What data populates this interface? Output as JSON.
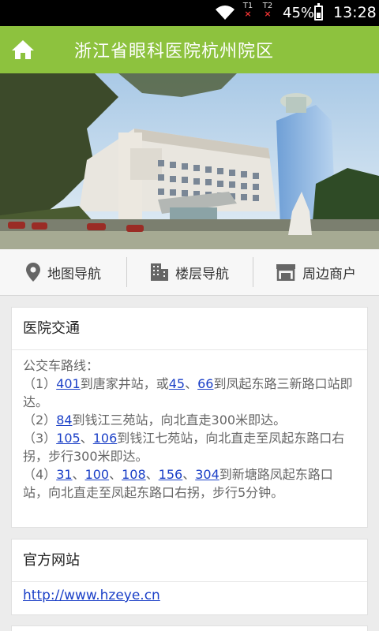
{
  "status_bar": {
    "sim1": "T1",
    "sim2": "T2",
    "battery_percent": "45%",
    "battery_level": 0.45,
    "time": "13:28"
  },
  "app_bar": {
    "title": "浙江省眼科医院杭州院区",
    "color": "#8dc23e"
  },
  "tabs": [
    {
      "label": "地图导航",
      "icon": "map-pin-icon"
    },
    {
      "label": "楼层导航",
      "icon": "building-icon"
    },
    {
      "label": "周边商户",
      "icon": "storefront-icon"
    }
  ],
  "traffic": {
    "title": "医院交通",
    "intro": "公交车路线：",
    "route1": {
      "prefix": "（1）",
      "bus1": "401",
      "t1": "到唐家井站，或",
      "bus2": "45",
      "sep": "、",
      "bus3": "66",
      "t2": "到凤起东路三新路口站即达。"
    },
    "route2": {
      "prefix": "（2）",
      "bus1": "84",
      "t1": "到钱江三苑站，向北直走300米即达。"
    },
    "route3": {
      "prefix": "（3）",
      "bus1": "105",
      "sep": "、",
      "bus2": "106",
      "t1": "到钱江七苑站，向北直走至凤起东路口右拐，步行300米即达。"
    },
    "route4": {
      "prefix": "（4）",
      "bus1": "31",
      "sep1": "、",
      "bus2": "100",
      "sep2": "、",
      "bus3": "108",
      "sep3": "、",
      "bus4": "156",
      "sep4": "、",
      "bus5": "304",
      "t1": "到新塘路凤起东路口站，向北直走至凤起东路口右拐，步行5分钟。"
    }
  },
  "website": {
    "title": "官方网站",
    "url": "http://www.hzeye.cn"
  }
}
